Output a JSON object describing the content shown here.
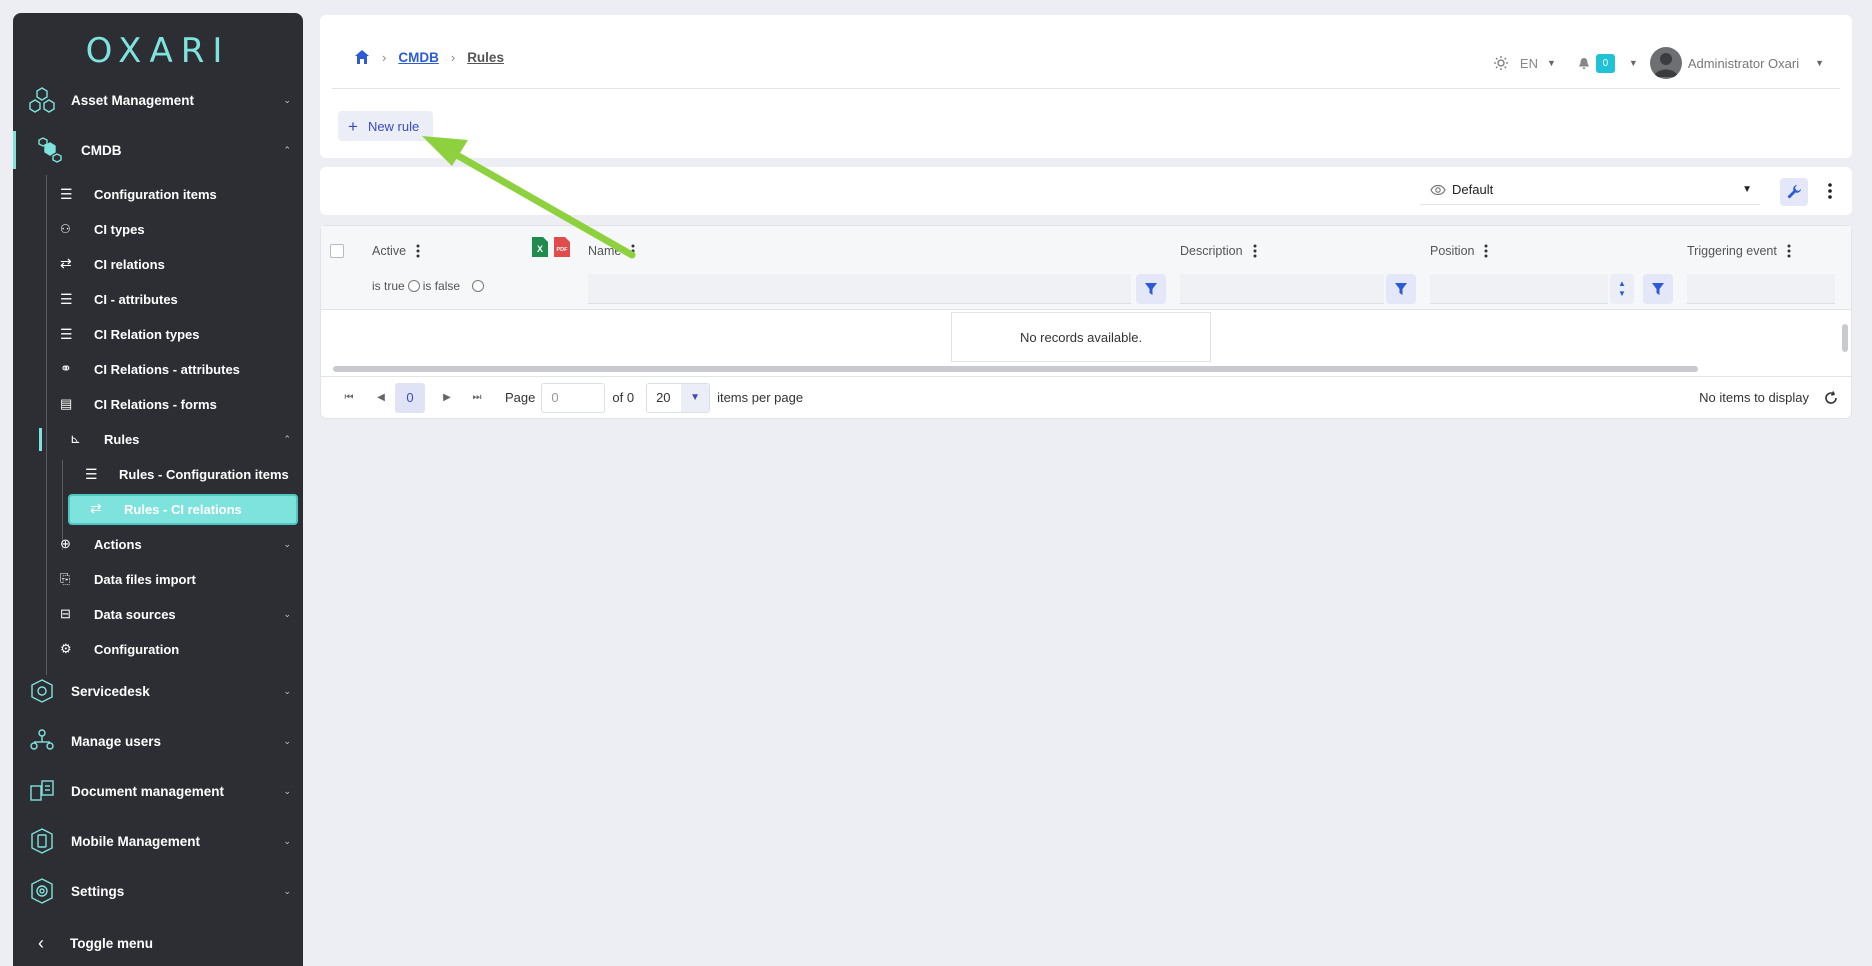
{
  "app": {
    "logo_text": "OXARI"
  },
  "sidebar": {
    "top_items": [
      {
        "label": "Asset Management"
      },
      {
        "label": "CMDB"
      },
      {
        "label": "Servicedesk"
      },
      {
        "label": "Manage users"
      },
      {
        "label": "Document management"
      },
      {
        "label": "Mobile Management"
      },
      {
        "label": "Settings"
      }
    ],
    "cmdb_items": [
      {
        "label": "Configuration items"
      },
      {
        "label": "CI types"
      },
      {
        "label": "CI relations"
      },
      {
        "label": "CI - attributes"
      },
      {
        "label": "CI Relation types"
      },
      {
        "label": "CI Relations - attributes"
      },
      {
        "label": "CI Relations - forms"
      },
      {
        "label": "Rules"
      },
      {
        "label": "Rules - Configuration items"
      },
      {
        "label": "Rules - CI relations"
      },
      {
        "label": "Actions"
      },
      {
        "label": "Data files import"
      },
      {
        "label": "Data sources"
      },
      {
        "label": "Configuration"
      }
    ],
    "toggle_label": "Toggle menu"
  },
  "breadcrumb": {
    "items": [
      "CMDB",
      "Rules"
    ]
  },
  "header": {
    "language": "EN",
    "notification_count": "0",
    "user_name": "Administrator Oxari",
    "new_rule_label": "New rule"
  },
  "toolbar": {
    "view_name": "Default"
  },
  "grid": {
    "columns": [
      "Active",
      "Name",
      "Description",
      "Position",
      "Triggering event"
    ],
    "bool_filter": {
      "true_label": "is true",
      "false_label": "is false"
    },
    "empty_message": "No records available."
  },
  "pager": {
    "current_page": "0",
    "page_label": "Page",
    "page_input_placeholder": "0",
    "of_label": "of 0",
    "page_size": "20",
    "per_page_label": "items per page",
    "status": "No items to display"
  },
  "colors": {
    "accent": "#7fe3dd",
    "sidebar_bg": "#2c2e33",
    "link": "#2d5bd7",
    "annotation_arrow": "#8ed13f"
  }
}
